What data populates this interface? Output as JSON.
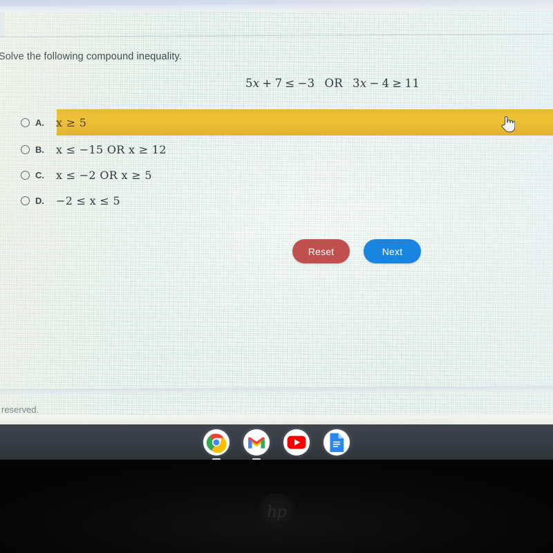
{
  "page": {
    "prompt": "Solve the following compound inequality.",
    "footer_text": "reserved."
  },
  "equation": {
    "left_coef": "5",
    "left_var": "x",
    "left_plus": "+",
    "left_const": "7",
    "left_rel": "≤",
    "left_rhs": "−3",
    "conjunction": "OR",
    "right_coef": "3",
    "right_var": "x",
    "right_minus": "−",
    "right_const": "4",
    "right_rel": "≥",
    "right_rhs": "11",
    "full_text": "5x + 7 ≤ −3   OR   3x − 4 ≥ 11"
  },
  "options": [
    {
      "letter": "A.",
      "math": "x ≥ 5",
      "selected": false,
      "highlighted": true
    },
    {
      "letter": "B.",
      "math": "x ≤ −15    OR    x ≥ 12",
      "selected": false,
      "highlighted": false
    },
    {
      "letter": "C.",
      "math": "x ≤ −2    OR    x ≥ 5",
      "selected": false,
      "highlighted": false
    },
    {
      "letter": "D.",
      "math": "−2 ≤ x ≤ 5",
      "selected": false,
      "highlighted": false
    }
  ],
  "buttons": {
    "reset_label": "Reset",
    "next_label": "Next"
  },
  "shelf": {
    "icons": [
      {
        "name": "chrome-icon",
        "label": "Chrome",
        "running": true
      },
      {
        "name": "gmail-icon",
        "label": "Gmail",
        "running": true
      },
      {
        "name": "youtube-icon",
        "label": "YouTube",
        "running": false
      },
      {
        "name": "google-docs-icon",
        "label": "Docs",
        "running": false
      }
    ]
  },
  "device": {
    "brand_logo": "hp"
  },
  "colors": {
    "highlight": "#e8b72c",
    "reset_button": "#c0504d",
    "next_button": "#1a85e0",
    "shelf": "#3d444c",
    "page_background": "#eef3ef",
    "text": "#3e4a4e"
  },
  "cursor": {
    "type": "pointing-hand"
  }
}
